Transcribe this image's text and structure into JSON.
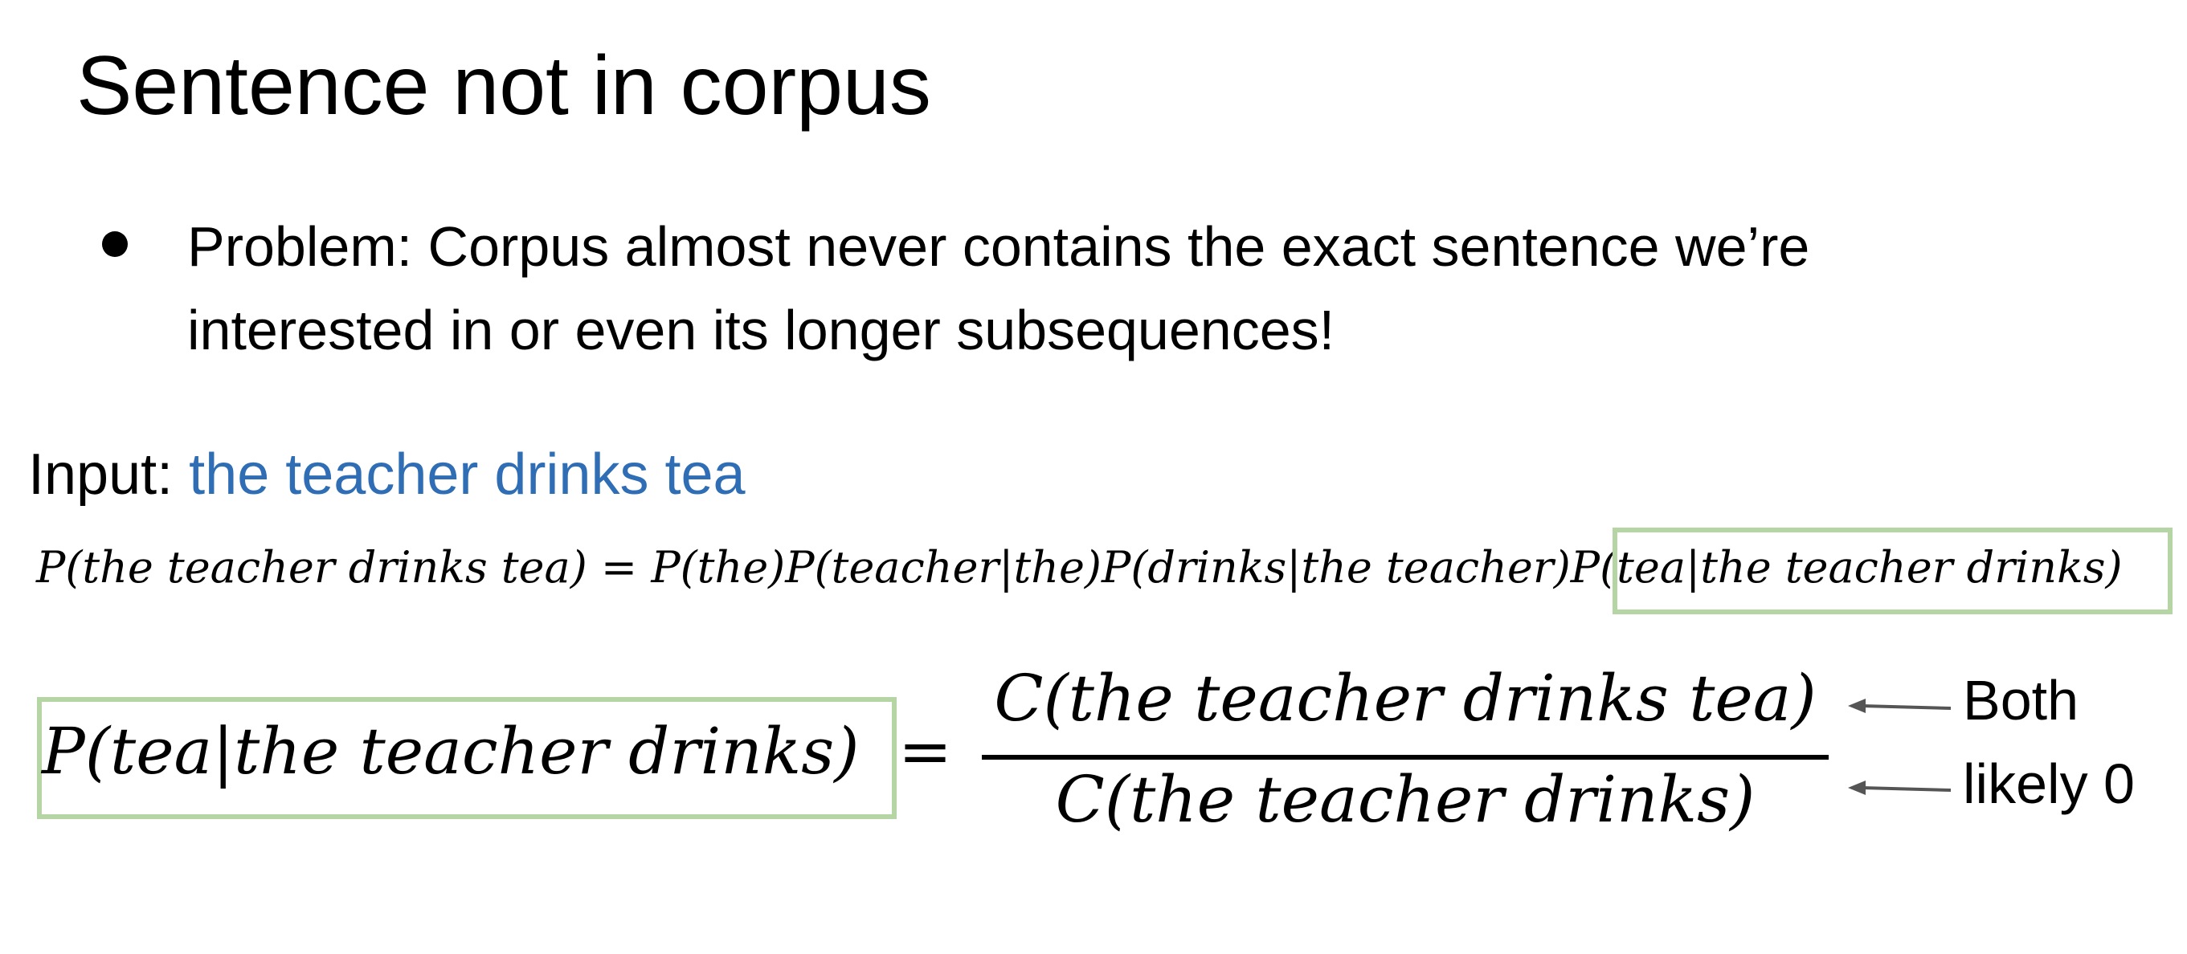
{
  "title": "Sentence not in corpus",
  "bullets": [
    "Problem: Corpus almost never contains the exact sentence we’re interested in or even its longer subsequences!"
  ],
  "input": {
    "label": "Input: ",
    "value": "the teacher drinks tea",
    "value_color": "#2f6db5"
  },
  "equation1": {
    "lhs": "P(the teacher drinks tea)",
    "equals": " = ",
    "terms": [
      "P(the)",
      "P(teacher|the)",
      "P(drinks|the teacher)"
    ],
    "highlighted_term": "P(tea|the teacher drinks)"
  },
  "equation2": {
    "lhs": "P(tea|the teacher drinks)",
    "equals": "=",
    "numerator": "C(the teacher drinks tea)",
    "denominator": "C(the teacher drinks)"
  },
  "annotation": "Both likely 0",
  "colors": {
    "highlight_box": "#b6d5a4",
    "arrow": "#555555",
    "text": "#000000"
  }
}
